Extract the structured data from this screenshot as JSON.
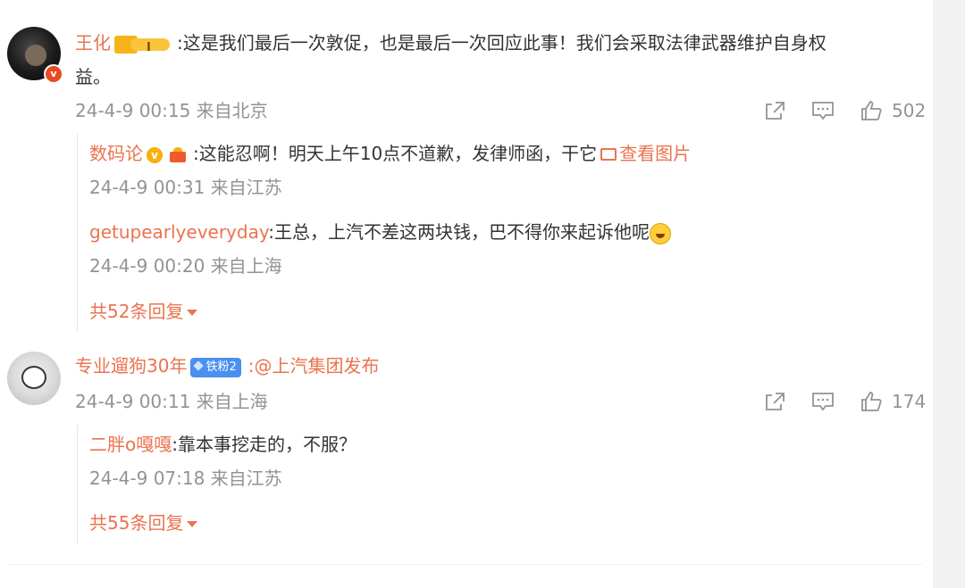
{
  "comments": [
    {
      "user": "王化",
      "badge_icon": "vip-level-badge",
      "badge_text": "I",
      "text": ":这是我们最后一次敦促，也是最后一次回应此事！我们会采取法律武器维护自身权",
      "text_cont": "益。",
      "meta": "24-4-9 00:15 来自北京",
      "likes": "502",
      "replies": [
        {
          "user": "数码论",
          "text": ":这能忍啊！明天上午10点不道歉，发律师函，干它",
          "link": "查看图片",
          "meta": "24-4-9 00:31 来自江苏"
        },
        {
          "user": "getupearlyeveryday",
          "text": ":王总，上汽不差这两块钱，巴不得你来起诉他呢",
          "meta": "24-4-9 00:20 来自上海"
        }
      ],
      "more_replies": "共52条回复"
    },
    {
      "user": "专业遛狗30年",
      "fan_badge": "铁粉2",
      "text": ":@上汽集团发布",
      "meta": "24-4-9 00:11 来自上海",
      "likes": "174",
      "replies": [
        {
          "user": "二胖o嘎嘎",
          "text": ":靠本事挖走的，不服？",
          "meta": "24-4-9 07:18 来自江苏"
        }
      ],
      "more_replies": "共55条回复"
    }
  ],
  "colors": {
    "name": "#eb7350",
    "text": "#333333",
    "meta": "#939393"
  }
}
